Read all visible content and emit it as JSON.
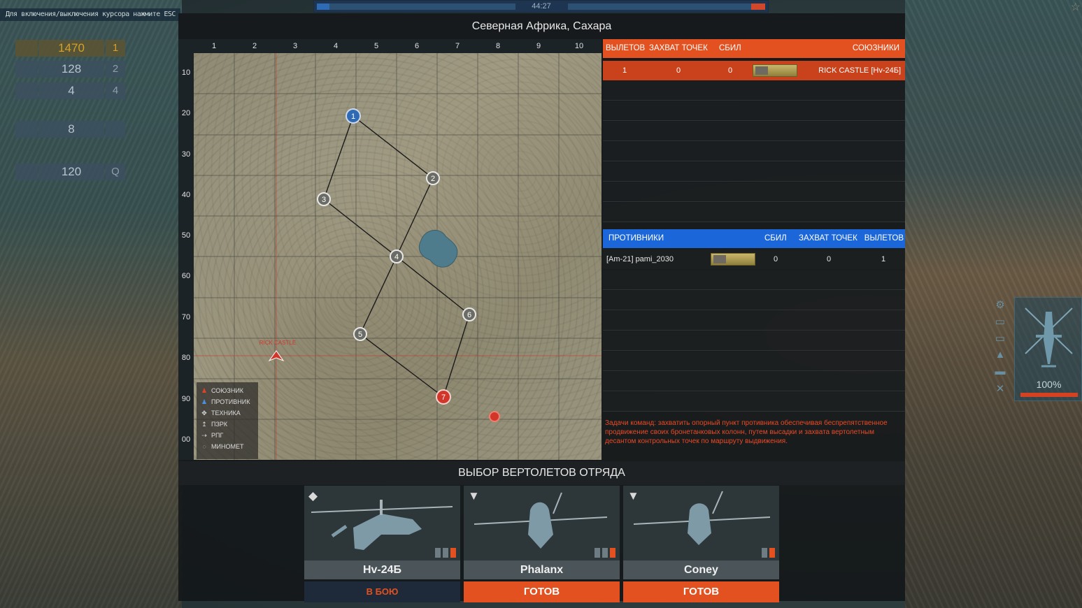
{
  "hud": {
    "hint": "Для включения/выключения курсора нажмите ESC",
    "timer": "44:27",
    "ally_color": "#2f6ab4",
    "enemy_color": "#d2462a"
  },
  "resources": [
    {
      "icon": "tank-shell-icon",
      "value": "1470",
      "key": "1"
    },
    {
      "icon": "missile-pod-icon",
      "value": "128",
      "key": "2"
    },
    {
      "icon": "rocket-icon",
      "value": "4",
      "key": "4"
    },
    {
      "icon": "flare-icon",
      "value": "8",
      "key": ""
    },
    {
      "icon": "troops-icon",
      "value": "120",
      "key": "Q"
    }
  ],
  "map": {
    "title": "Северная Африка, Сахара",
    "columns": [
      "1",
      "2",
      "3",
      "4",
      "5",
      "6",
      "7",
      "8",
      "9",
      "10"
    ],
    "rows": [
      "10",
      "20",
      "30",
      "40",
      "50",
      "60",
      "70",
      "80",
      "90",
      "00"
    ],
    "player_label": "RICK CASTLE",
    "waypoints": [
      "1",
      "2",
      "3",
      "4",
      "5",
      "6",
      "7"
    ],
    "legend": [
      {
        "icon": "ally-soldier-icon",
        "label": "СОЮЗНИК"
      },
      {
        "icon": "enemy-soldier-icon",
        "label": "ПРОТИВНИК"
      },
      {
        "icon": "vehicle-icon",
        "label": "ТЕХНИКА"
      },
      {
        "icon": "manpads-icon",
        "label": "ПЗРК"
      },
      {
        "icon": "rpg-icon",
        "label": "РПГ"
      },
      {
        "icon": "mortar-icon",
        "label": "МИНОМЕТ"
      }
    ]
  },
  "allies": {
    "header": {
      "sorties": "ВЫЛЕТОВ",
      "captures": "ЗАХВАТ ТОЧЕК",
      "kills": "СБИЛ",
      "title": "СОЮЗНИКИ"
    },
    "rows": [
      {
        "sorties": "1",
        "captures": "0",
        "kills": "0",
        "name": "RICK CASTLE [Hv-24Б]"
      }
    ]
  },
  "enemies": {
    "header": {
      "title": "ПРОТИВНИКИ",
      "kills": "СБИЛ",
      "captures": "ЗАХВАТ ТОЧЕК",
      "sorties": "ВЫЛЕТОВ"
    },
    "rows": [
      {
        "name": "[Am-21] pami_2030",
        "kills": "0",
        "captures": "0",
        "sorties": "1"
      }
    ]
  },
  "mission_text": "Задачи команд: захватить опорный пункт противника обеспечивая беспрепятственное продвижение своих бронетанковых колонн, путем высадки и захвата вертолетным десантом контрольных точек по маршруту выдвижения.",
  "squad": {
    "title": "ВЫБОР ВЕРТОЛЕТОВ ОТРЯДА",
    "helicopters": [
      {
        "name": "Hv-24Б",
        "status": "В БОЮ",
        "marker": "◆"
      },
      {
        "name": "Phalanx",
        "status": "ГОТОВ",
        "marker": "▼"
      },
      {
        "name": "Coney",
        "status": "ГОТОВ",
        "marker": "▼"
      }
    ]
  },
  "vehicle": {
    "health": "100%",
    "health_fraction": 1.0
  }
}
